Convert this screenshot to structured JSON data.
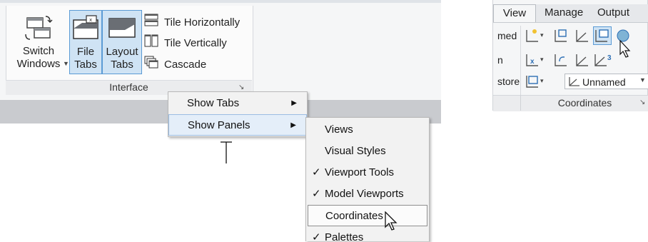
{
  "interface_panel": {
    "switch_windows": {
      "line1": "Switch",
      "line2": "Windows"
    },
    "file_tabs": {
      "line1": "File",
      "line2": "Tabs"
    },
    "layout_tabs": {
      "line1": "Layout",
      "line2": "Tabs"
    },
    "tile_horizontally": "Tile Horizontally",
    "tile_vertically": "Tile Vertically",
    "cascade": "Cascade",
    "title": "Interface"
  },
  "context_menu": {
    "items": [
      {
        "label": "Show Tabs"
      },
      {
        "label": "Show Panels"
      }
    ]
  },
  "panels_submenu": {
    "items": [
      {
        "label": "Views",
        "checked": false
      },
      {
        "label": "Visual Styles",
        "checked": false
      },
      {
        "label": "Viewport Tools",
        "checked": true
      },
      {
        "label": "Model Viewports",
        "checked": true
      },
      {
        "label": "Coordinates",
        "checked": false
      },
      {
        "label": "Palettes",
        "checked": true
      }
    ],
    "check_glyph": "✓"
  },
  "right_ribbon": {
    "tabs": [
      "View",
      "Manage",
      "Output"
    ],
    "left_labels": [
      "med",
      "n",
      "store"
    ],
    "combo_value": "Unnamed",
    "panel_title": "Coordinates"
  },
  "colors": {
    "selected_fill": "#cfe3f4",
    "selected_border": "#5b9bd5",
    "icon_blue": "#2d6fb5"
  }
}
